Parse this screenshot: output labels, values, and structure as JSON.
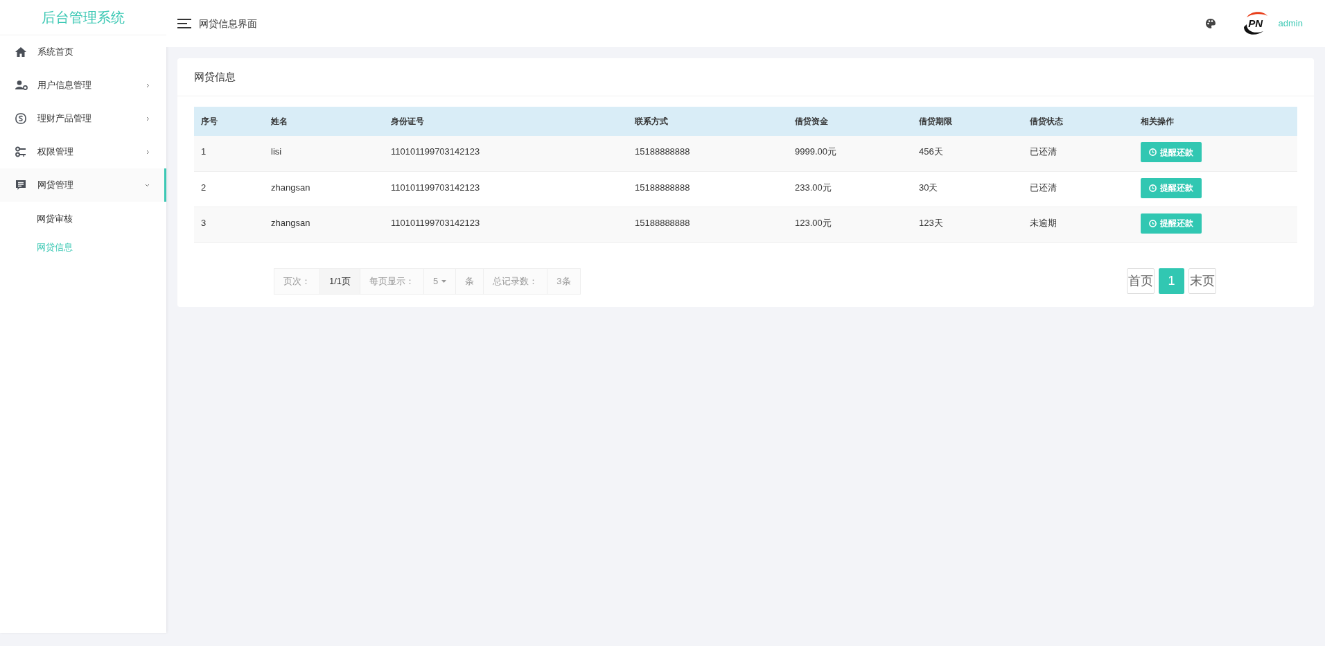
{
  "sidebar": {
    "title": "后台管理系统",
    "items": [
      {
        "label": "系统首页",
        "selected": false
      },
      {
        "label": "用户信息管理",
        "selected": false,
        "expanded": false
      },
      {
        "label": "理财产品管理",
        "selected": false,
        "expanded": false
      },
      {
        "label": "权限管理",
        "selected": false,
        "expanded": false
      },
      {
        "label": "网贷管理",
        "selected": true,
        "expanded": true,
        "children": [
          {
            "label": "网贷审核",
            "selected": false
          },
          {
            "label": "网贷信息",
            "selected": true
          }
        ]
      }
    ]
  },
  "header": {
    "title": "网贷信息界面",
    "avatar_logo": "PN",
    "user": "admin"
  },
  "card": {
    "title": "网贷信息",
    "table": {
      "columns": [
        "序号",
        "姓名",
        "身份证号",
        "联系方式",
        "借贷资金",
        "借贷期限",
        "借贷状态",
        "相关操作"
      ],
      "rows": [
        {
          "cells": [
            "1",
            "lisi",
            "110101199703142123",
            "15188888888",
            "9999.00元",
            "456天",
            "已还清"
          ],
          "action": "提醒还款"
        },
        {
          "cells": [
            "2",
            "zhangsan",
            "110101199703142123",
            "15188888888",
            "233.00元",
            "30天",
            "已还清"
          ],
          "action": "提醒还款"
        },
        {
          "cells": [
            "3",
            "zhangsan",
            "110101199703142123",
            "15188888888",
            "123.00元",
            "123天",
            "未逾期"
          ],
          "action": "提醒还款"
        }
      ]
    },
    "pagination": {
      "page_label": "页次：",
      "page": "1/1页",
      "per_page_label": "每页显示：",
      "per_page": "5",
      "per_page_unit": "条",
      "total_label": "总记录数：",
      "total": "3条",
      "buttons": [
        {
          "label": "首页",
          "selected": false
        },
        {
          "label": "1",
          "selected": true
        },
        {
          "label": "末页",
          "selected": false
        }
      ]
    }
  }
}
